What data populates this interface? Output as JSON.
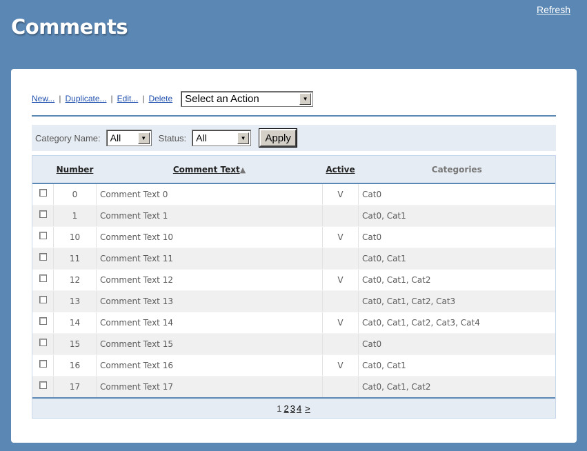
{
  "header": {
    "title": "Comments",
    "refresh_label": "Refresh"
  },
  "toolbar": {
    "new_label": "New...",
    "duplicate_label": "Duplicate...",
    "edit_label": "Edit...",
    "delete_label": "Delete",
    "separator": "|",
    "action_select_value": "Select an Action"
  },
  "filters": {
    "category_label": "Category Name:",
    "category_value": "All",
    "status_label": "Status:",
    "status_value": "All",
    "apply_label": "Apply"
  },
  "table": {
    "columns": {
      "number": "Number",
      "comment_text": "Comment Text",
      "sort_indicator": "▲",
      "active": "Active",
      "categories": "Categories"
    },
    "rows": [
      {
        "number": "0",
        "text": "Comment Text 0",
        "active": "V",
        "categories": "Cat0"
      },
      {
        "number": "1",
        "text": "Comment Text 1",
        "active": "",
        "categories": "Cat0, Cat1"
      },
      {
        "number": "10",
        "text": "Comment Text 10",
        "active": "V",
        "categories": "Cat0"
      },
      {
        "number": "11",
        "text": "Comment Text 11",
        "active": "",
        "categories": "Cat0, Cat1"
      },
      {
        "number": "12",
        "text": "Comment Text 12",
        "active": "V",
        "categories": "Cat0, Cat1, Cat2"
      },
      {
        "number": "13",
        "text": "Comment Text 13",
        "active": "",
        "categories": "Cat0, Cat1, Cat2, Cat3"
      },
      {
        "number": "14",
        "text": "Comment Text 14",
        "active": "V",
        "categories": "Cat0, Cat1, Cat2, Cat3, Cat4"
      },
      {
        "number": "15",
        "text": "Comment Text 15",
        "active": "",
        "categories": "Cat0"
      },
      {
        "number": "16",
        "text": "Comment Text 16",
        "active": "V",
        "categories": "Cat0, Cat1"
      },
      {
        "number": "17",
        "text": "Comment Text 17",
        "active": "",
        "categories": "Cat0, Cat1, Cat2"
      }
    ]
  },
  "pager": {
    "current": "1",
    "pages": [
      "2",
      "3",
      "4"
    ],
    "next": ">"
  },
  "colors": {
    "background": "#5b87b4",
    "link": "#1f4fae",
    "filter_bar": "#e6ecf3"
  },
  "icons": {
    "dropdown": "chevron-down-icon",
    "sort": "sort-ascending-icon",
    "checkbox": "checkbox-icon"
  }
}
